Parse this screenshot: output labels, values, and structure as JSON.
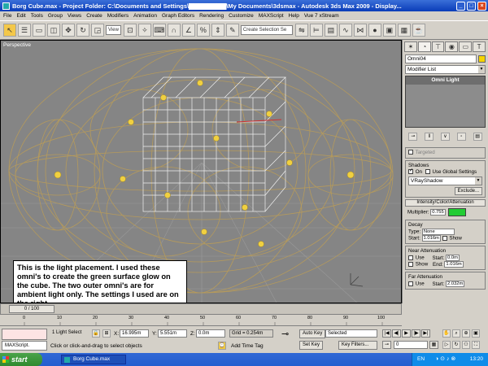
{
  "window": {
    "title": "Borg Cube.max    - Project Folder: C:\\Documents and Settings\\▇▇▇▇▇▇▇▇\\My Documents\\3dsmax    - Autodesk 3ds Max  2009    - Display...",
    "min": "_",
    "max": "□",
    "close": "×"
  },
  "menu": [
    "File",
    "Edit",
    "Tools",
    "Group",
    "Views",
    "Create",
    "Modifiers",
    "Animation",
    "Graph Editors",
    "Rendering",
    "Customize",
    "MAXScript",
    "Help",
    "Vue 7 xStream"
  ],
  "toolbar": {
    "view_select": "View",
    "selection_set": "Create Selection Se"
  },
  "viewport": {
    "label": "Perspective",
    "note": "This is the light placement.  I used these omni's to create the green surface glow on the cube. The two outer omni's are for ambient light only. The settings I used are on the right..."
  },
  "panel": {
    "object_name": "Omni04",
    "modifier_list": "Modifier List",
    "stack_item": "Omni Light",
    "targeted": "Targeted",
    "shadows_title": "Shadows",
    "shadows_on": "On",
    "use_global": "Use Global Settings",
    "shadow_type": "VRayShadow",
    "exclude": "Exclude...",
    "intensity_title": "Intensity/Color/Attenuation",
    "multiplier_label": "Multiplier:",
    "multiplier_value": "0.755",
    "decay_title": "Decay",
    "type_label": "Type:",
    "type_value": "None",
    "start_label": "Start:",
    "decay_start": "1.016m",
    "show": "Show",
    "near_title": "Near Attenuation",
    "use": "Use",
    "near_start": "0.0m",
    "end_label": "End:",
    "near_end": "1.016m",
    "far_title": "Far Attenuation",
    "far_start": "2.032m"
  },
  "timeline": {
    "frame": "0 / 100",
    "ticks": [
      "0",
      "10",
      "20",
      "30",
      "40",
      "50",
      "60",
      "70",
      "80",
      "90",
      "100"
    ]
  },
  "status": {
    "maxscript": "MAXScript.",
    "selection": "1 Light Select",
    "x_label": "X:",
    "x_value": "16.995m",
    "y_label": "Y:",
    "y_value": "5.551m",
    "z_label": "Z:",
    "z_value": "0.0m",
    "grid": "Grid = 0.254m",
    "prompt": "Click or click-and-drag to select objects",
    "add_time_tag": "Add Time Tag",
    "auto_key": "Auto Key",
    "selected": "Selected",
    "set_key": "Set Key",
    "key_filters": "Key Filters...",
    "frame_value": "0"
  },
  "taskbar": {
    "start": "start",
    "task": "Borg Cube.max",
    "lang": "EN",
    "clock": "13:20"
  }
}
